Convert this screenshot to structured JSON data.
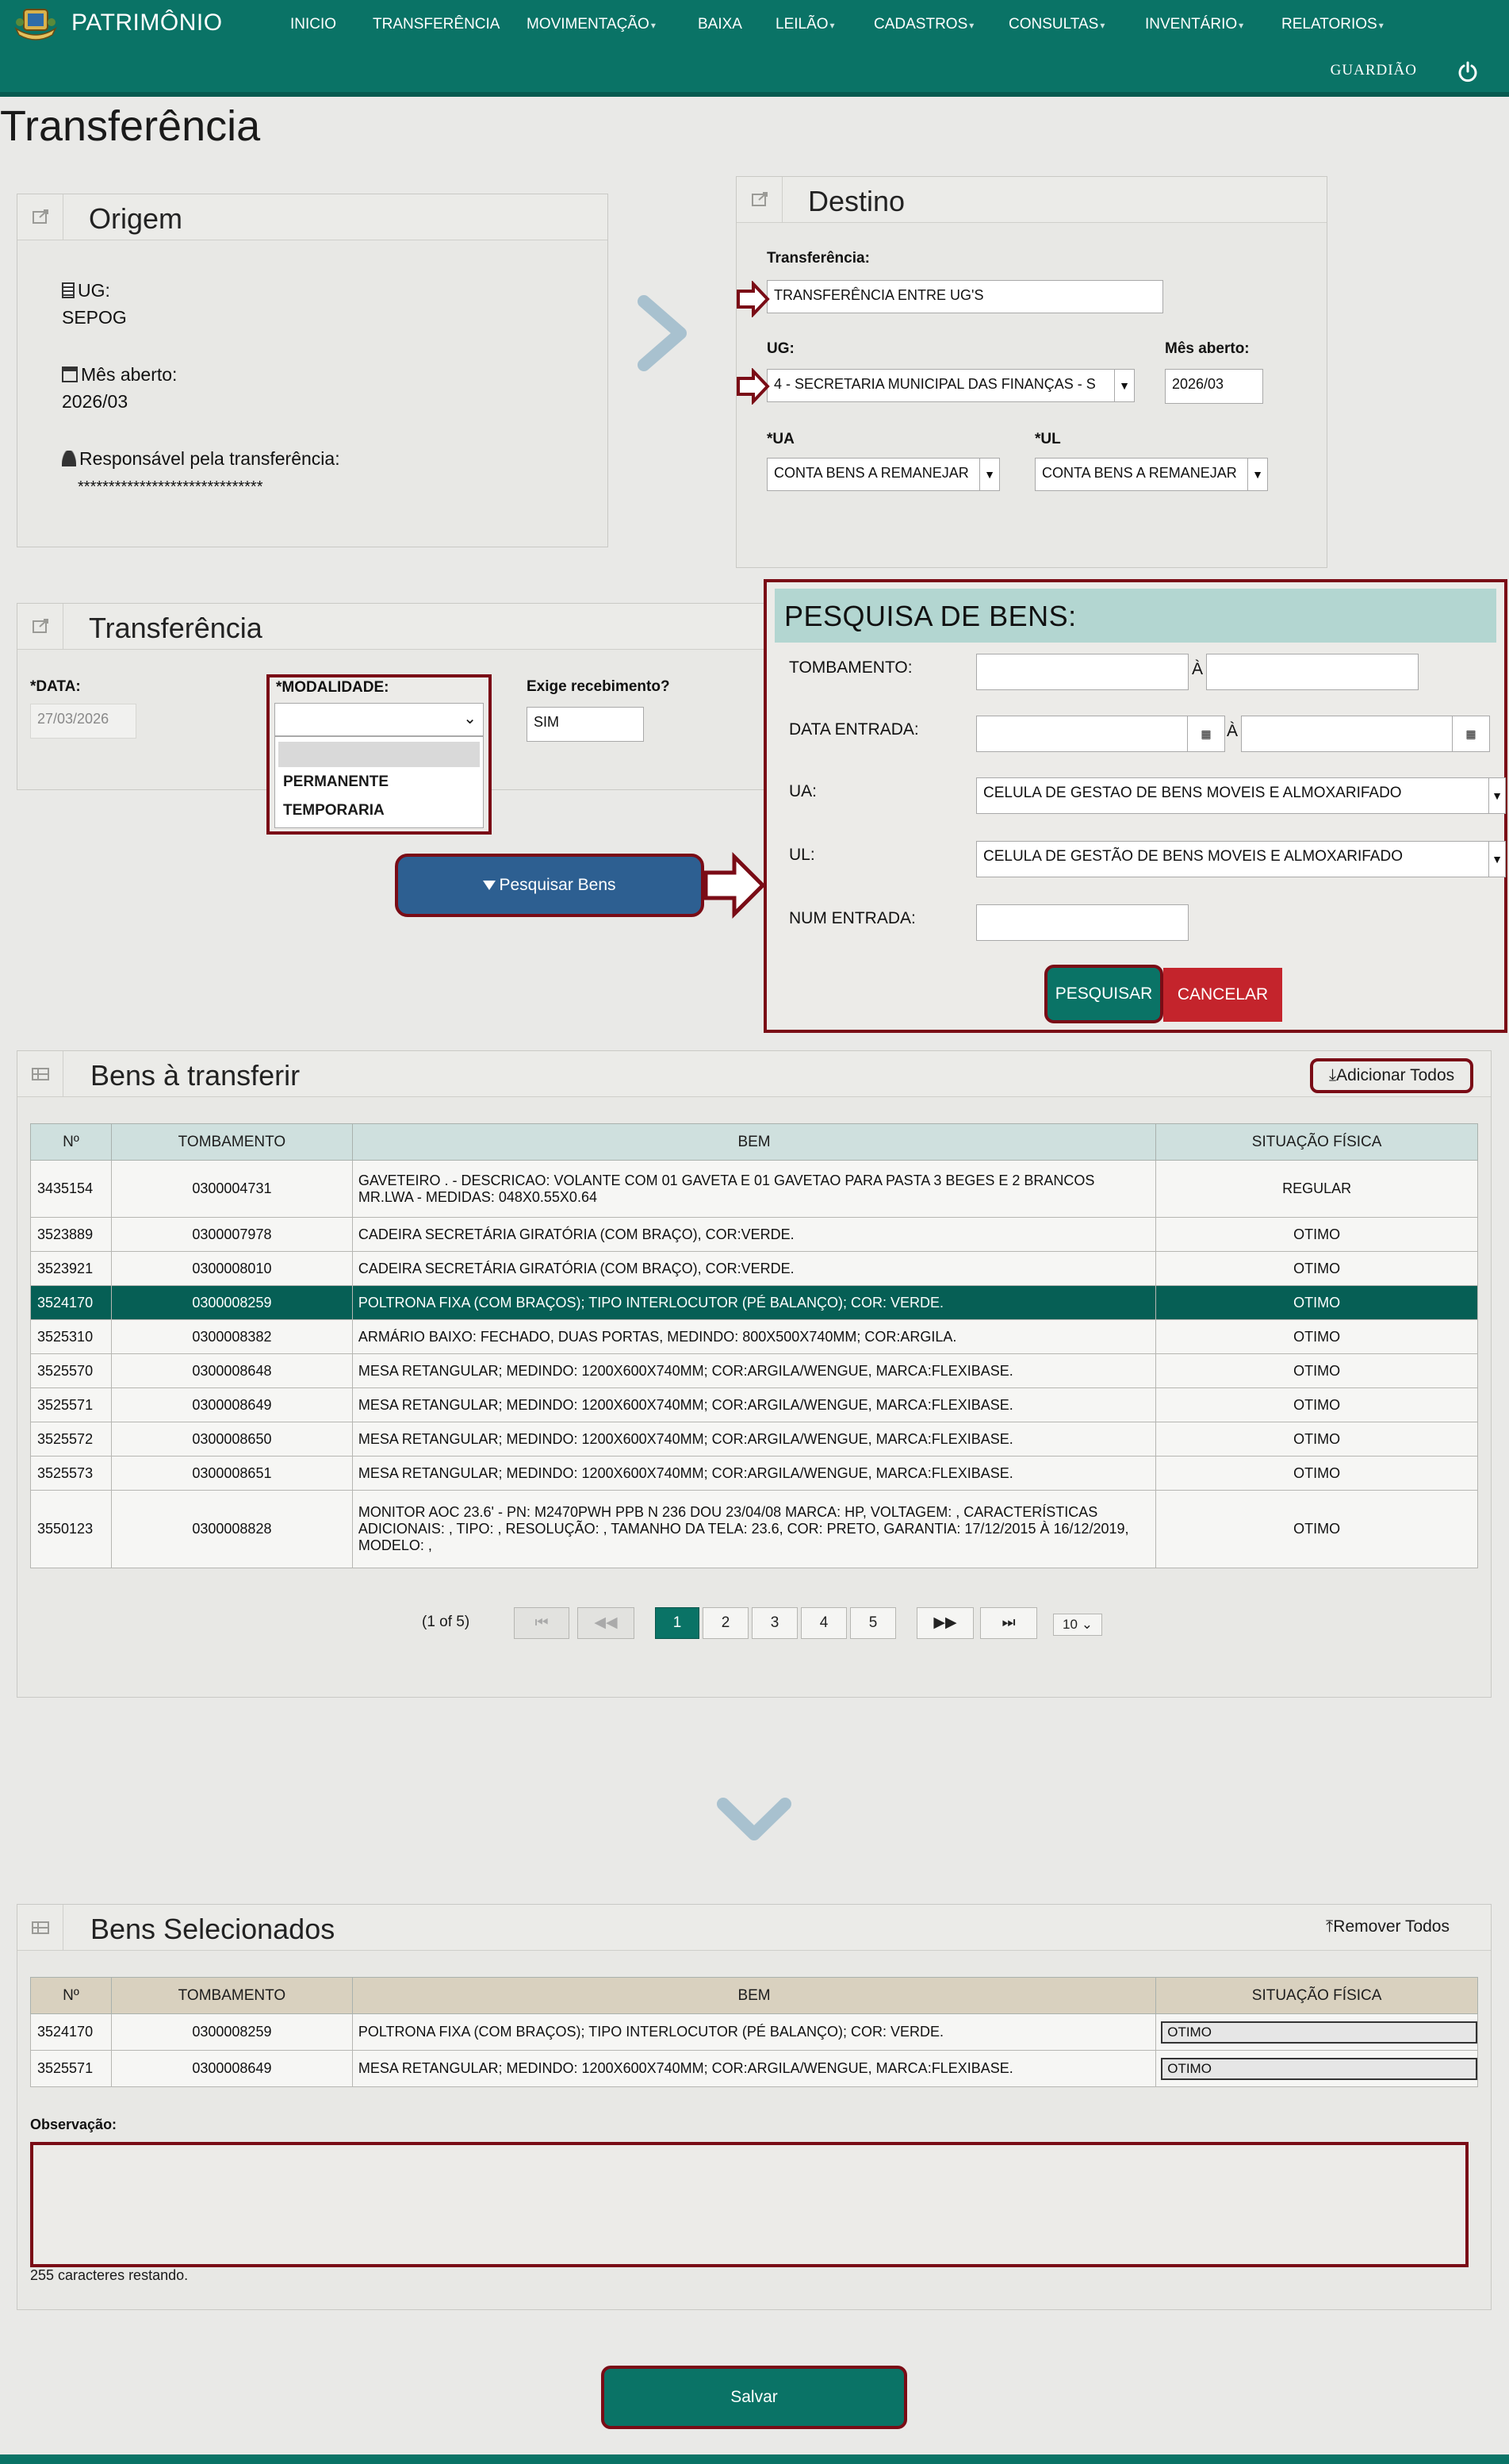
{
  "nav": {
    "brand": "PATRIMÔNIO",
    "items": [
      {
        "label": "INICIO",
        "dropdown": false
      },
      {
        "label": "TRANSFERÊNCIA",
        "dropdown": false
      },
      {
        "label": "MOVIMENTAÇÃO",
        "dropdown": true
      },
      {
        "label": "BAIXA",
        "dropdown": false
      },
      {
        "label": "LEILÃO",
        "dropdown": true
      },
      {
        "label": "CADASTROS",
        "dropdown": true
      },
      {
        "label": "CONSULTAS",
        "dropdown": true
      },
      {
        "label": "INVENTÁRIO",
        "dropdown": true
      },
      {
        "label": "RELATORIOS",
        "dropdown": true
      }
    ],
    "user": "GUARDIÃO"
  },
  "page_title": "Transferência",
  "origem": {
    "title": "Origem",
    "ug_label": "UG:",
    "ug_value": "SEPOG",
    "mes_label": "Mês aberto:",
    "mes_value": "2026/03",
    "resp_label": "Responsável pela transferência:",
    "resp_value": "******************************"
  },
  "destino": {
    "title": "Destino",
    "transferencia_label": "Transferência:",
    "transferencia_value": "TRANSFERÊNCIA ENTRE UG'S",
    "ug_label": "UG:",
    "ug_value": "4 - SECRETARIA MUNICIPAL DAS FINANÇAS - S",
    "mes_label": "Mês aberto:",
    "mes_value": "2026/03",
    "ua_label": "*UA",
    "ua_value": "CONTA BENS A REMANEJAR",
    "ul_label": "*UL",
    "ul_value": "CONTA BENS A REMANEJAR"
  },
  "transfer": {
    "title": "Transferência",
    "data_label": "*DATA:",
    "data_value": "27/03/2026",
    "modalidade_label": "*MODALIDADE:",
    "modalidade_options": [
      "PERMANENTE",
      "TEMPORARIA"
    ],
    "recebimento_label": "Exige recebimento?",
    "recebimento_value": "SIM",
    "search_button": "Pesquisar Bens"
  },
  "search": {
    "title": "PESQUISA DE BENS:",
    "tombamento_label": "TOMBAMENTO:",
    "a_label": "À",
    "data_entrada_label": "DATA ENTRADA:",
    "ua_label": "UA:",
    "ua_value": "CELULA DE GESTAO DE BENS MOVEIS E ALMOXARIFADO",
    "ul_label": "UL:",
    "ul_value": "CELULA DE GESTÃO DE BENS MOVEIS E ALMOXARIFADO",
    "num_entrada_label": "NUM ENTRADA:",
    "pesquisar": "PESQUISAR",
    "cancelar": "CANCELAR"
  },
  "bens": {
    "title": "Bens à transferir",
    "add_all": "Adicionar Todos",
    "columns": [
      "Nº",
      "TOMBAMENTO",
      "BEM",
      "SITUAÇÃO FÍSICA"
    ],
    "rows": [
      [
        "3435154",
        "0300004731",
        "GAVETEIRO . - DESCRICAO: VOLANTE COM 01 GAVETA E 01 GAVETAO PARA PASTA 3 BEGES E 2 BRANCOS MR.LWA - MEDIDAS: 048X0.55X0.64",
        "REGULAR"
      ],
      [
        "3523889",
        "0300007978",
        "CADEIRA SECRETÁRIA GIRATÓRIA (COM BRAÇO), COR:VERDE.",
        "OTIMO"
      ],
      [
        "3523921",
        "0300008010",
        "CADEIRA SECRETÁRIA GIRATÓRIA (COM BRAÇO), COR:VERDE.",
        "OTIMO"
      ],
      [
        "3524170",
        "0300008259",
        "POLTRONA FIXA (COM BRAÇOS); TIPO INTERLOCUTOR (PÉ BALANÇO); COR: VERDE.",
        "OTIMO"
      ],
      [
        "3525310",
        "0300008382",
        "ARMÁRIO BAIXO: FECHADO, DUAS PORTAS, MEDINDO: 800X500X740MM; COR:ARGILA.",
        "OTIMO"
      ],
      [
        "3525570",
        "0300008648",
        "MESA RETANGULAR; MEDINDO: 1200X600X740MM; COR:ARGILA/WENGUE, MARCA:FLEXIBASE.",
        "OTIMO"
      ],
      [
        "3525571",
        "0300008649",
        "MESA RETANGULAR; MEDINDO: 1200X600X740MM; COR:ARGILA/WENGUE, MARCA:FLEXIBASE.",
        "OTIMO"
      ],
      [
        "3525572",
        "0300008650",
        "MESA RETANGULAR; MEDINDO: 1200X600X740MM; COR:ARGILA/WENGUE, MARCA:FLEXIBASE.",
        "OTIMO"
      ],
      [
        "3525573",
        "0300008651",
        "MESA RETANGULAR; MEDINDO: 1200X600X740MM; COR:ARGILA/WENGUE, MARCA:FLEXIBASE.",
        "OTIMO"
      ],
      [
        "3550123",
        "0300008828",
        "MONITOR AOC 23.6' - PN: M2470PWH PPB N 236 DOU 23/04/08 MARCA: HP, VOLTAGEM: , CARACTERÍSTICAS ADICIONAIS: , TIPO: , RESOLUÇÃO: , TAMANHO DA TELA: 23.6, COR: PRETO, GARANTIA: 17/12/2015 À 16/12/2019, MODELO: ,",
        "OTIMO"
      ]
    ],
    "selected_row": "3524170",
    "pager": {
      "summary": "(1 of 5)",
      "first": "⏮",
      "prev": "◀◀",
      "next": "▶▶",
      "last": "⏭",
      "pages": [
        "1",
        "2",
        "3",
        "4",
        "5"
      ],
      "current": "1",
      "rows_per_page": "10"
    }
  },
  "selecionados": {
    "title": "Bens Selecionados",
    "remove_all": "Remover Todos",
    "columns": [
      "Nº",
      "TOMBAMENTO",
      "BEM",
      "SITUAÇÃO FÍSICA"
    ],
    "rows": [
      [
        "3524170",
        "0300008259",
        "POLTRONA FIXA (COM BRAÇOS); TIPO INTERLOCUTOR (PÉ BALANÇO); COR: VERDE.",
        "OTIMO"
      ],
      [
        "3525571",
        "0300008649",
        "MESA RETANGULAR; MEDINDO: 1200X600X740MM; COR:ARGILA/WENGUE, MARCA:FLEXIBASE.",
        "OTIMO"
      ]
    ],
    "obs_label": "Observação:",
    "chars_left": "255 caracteres restando."
  },
  "save": "Salvar",
  "colors": {
    "nav": "#0a7366",
    "teal_button": "#0a7366",
    "red_button": "#c4242c",
    "blue_button": "#2d5f91",
    "highlight_border": "#7a0c16",
    "table_header": "#cfe0de",
    "selected_row": "#065f55"
  }
}
